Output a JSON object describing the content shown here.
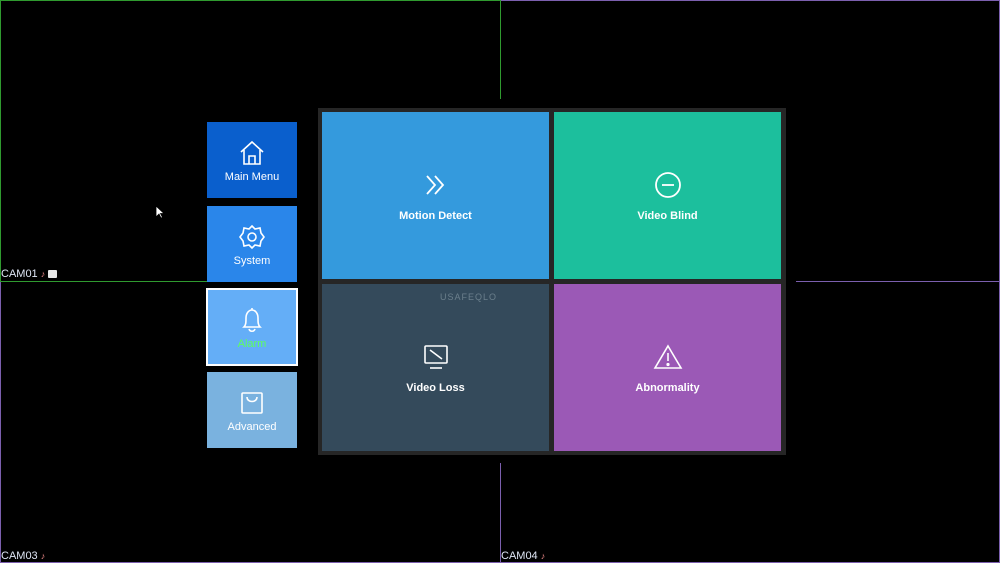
{
  "cameras": [
    {
      "label": "CAM01"
    },
    {
      "label": "CAM03"
    },
    {
      "label": "CAM04"
    }
  ],
  "sidebar": {
    "items": [
      {
        "label": "Main Menu",
        "icon": "home-icon",
        "color": "#0a5fcd"
      },
      {
        "label": "System",
        "icon": "gear-icon",
        "color": "#2a86ea"
      },
      {
        "label": "Alarm",
        "icon": "bell-icon",
        "color": "#64aef7",
        "active": true,
        "label_color": "#5dff5d"
      },
      {
        "label": "Advanced",
        "icon": "bag-icon",
        "color": "#7ab2df"
      }
    ]
  },
  "alarm_menu": {
    "tiles": [
      {
        "label": "Motion Detect",
        "icon": "double-chevron-right-icon",
        "color": "#349add"
      },
      {
        "label": "Video Blind",
        "icon": "minus-circle-icon",
        "color": "#1cbf9d"
      },
      {
        "label": "Video Loss",
        "icon": "video-loss-icon",
        "color": "#344a5b"
      },
      {
        "label": "Abnormality",
        "icon": "warning-icon",
        "color": "#9b59b6"
      }
    ]
  },
  "watermark": "USAFEQLO",
  "colors": {
    "grid_green": "#2f9a2f",
    "grid_purple": "#7b5fae",
    "background": "#000000"
  }
}
